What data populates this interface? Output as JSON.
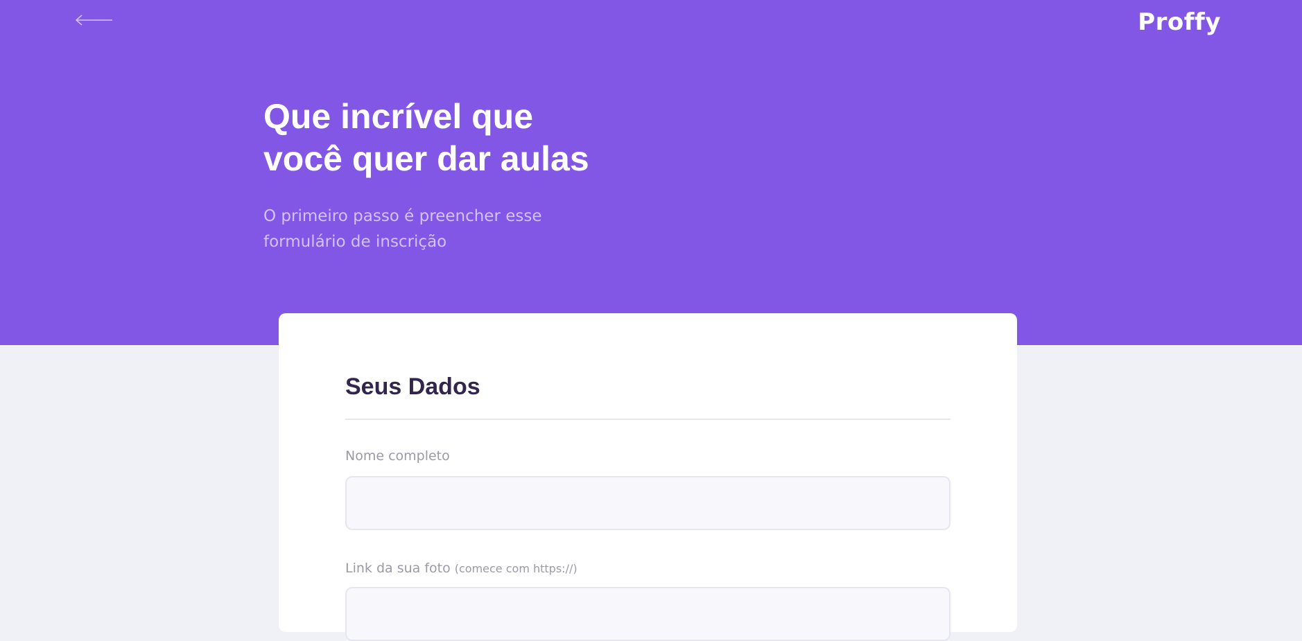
{
  "header": {
    "back_icon": "arrow-left-icon",
    "logo_text": "Proffy",
    "title_line1": "Que incrível que",
    "title_line2": "você quer dar aulas",
    "subtitle_line1": "O primeiro passo é preencher esse",
    "subtitle_line2": "formulário de inscrição"
  },
  "form": {
    "section_title": "Seus Dados",
    "fields": [
      {
        "label": "Nome completo",
        "value": ""
      },
      {
        "label": "Link da sua foto",
        "hint": "(comece com https://)",
        "value": ""
      }
    ]
  },
  "colors": {
    "primary": "#8257E5",
    "background": "#F0F0F7",
    "title_text": "#32264D",
    "label_text": "#9C98A6",
    "subtitle_text": "#D4C2FF",
    "input_background": "#F8F8FC",
    "input_border": "#E6E6F0"
  }
}
